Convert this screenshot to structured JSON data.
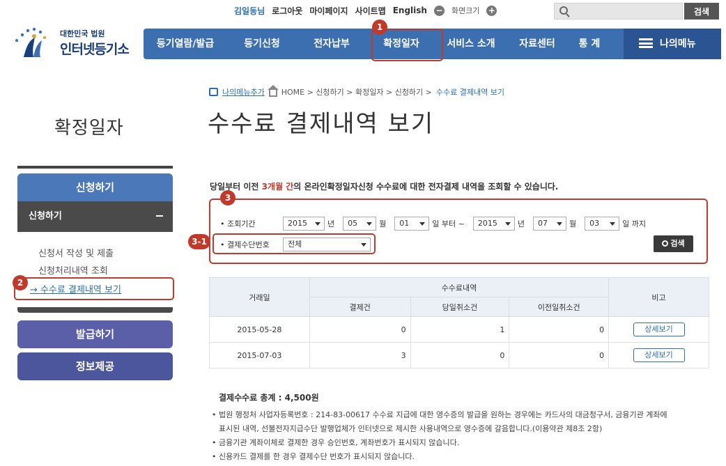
{
  "header": {
    "user_name": "김일동님",
    "logout": "로그아웃",
    "mypage": "마이페이지",
    "sitemap": "사이트맵",
    "english": "English",
    "font_size": "화면크기",
    "search_placeholder": "",
    "search_button": "검색"
  },
  "logo": {
    "sub": "대한민국 법원",
    "main": "인터넷등기소"
  },
  "nav": {
    "items": [
      "등기열람/발급",
      "등기신청",
      "전자납부",
      "확정일자",
      "서비스 소개",
      "자료센터",
      "통 계"
    ],
    "mymenu": "나의메뉴"
  },
  "badges": {
    "b1": "1",
    "b2": "2",
    "b3": "3",
    "b31": "3-1"
  },
  "breadcrumb": {
    "add": "나의메뉴추가",
    "path": "HOME > 신청하기 > 확정일자 > 신청하기 >",
    "current": "수수료 결제내역 보기"
  },
  "page_title": "수수료 결제내역 보기",
  "side_title": "확정일자",
  "sidebar": {
    "head": "신청하기",
    "sub": "신청하기",
    "links": [
      "신청서 작성 및 제출",
      "신청처리내역 조회",
      "→ 수수료 결제내역 보기"
    ],
    "btn_issue": "발급하기",
    "btn_info": "정보제공"
  },
  "intro": {
    "pre": "당일부터 이전 ",
    "red": "3개월 간",
    "post": "의 온라인확정일자신청 수수료에 대한 전자결제 내역을 조회할 수 있습니다."
  },
  "search": {
    "period_label": "• 조회기간",
    "from_year": "2015",
    "from_month": "05",
    "from_day": "01",
    "to_year": "2015",
    "to_month": "07",
    "to_day": "03",
    "unit_year": "년",
    "unit_month": "월",
    "unit_from": "일 부터 ~",
    "unit_to": "일 까지",
    "method_label": "• 결제수단번호",
    "method_value": "전체",
    "query_button": "검색"
  },
  "table": {
    "headers": {
      "date": "거래일",
      "fee": "수수료내역",
      "paid": "결제건",
      "cancel_today": "당일취소건",
      "cancel_prev": "이전일취소건",
      "note": "비고"
    },
    "rows": [
      {
        "date": "2015-05-28",
        "paid": "0",
        "cancel_today": "1",
        "cancel_prev": "0",
        "detail": "상세보기"
      },
      {
        "date": "2015-07-03",
        "paid": "3",
        "cancel_today": "0",
        "cancel_prev": "0",
        "detail": "상세보기"
      }
    ]
  },
  "total": "결제수수료 총계 : 4,500원",
  "notes": [
    "법원 행정처 사업자등록번호 : 214-83-00617 수수료 지급에 대한 영수증의 발급을 원하는 경우에는 카드사의 대금청구서, 금융기관 계좌에",
    "표시된 내역, 선불전자지급수단 발행업체가 인터넷으로 제시한 사용내역으로 영수증에 갈음합니다.(이용약관 제8조 2항)",
    "금융기관 계좌이체로 결제한 경우 승인번호, 계좌번호가 표시되지 않습니다.",
    "신용카드 결제를 한 경우 결제수단 번호가 표시되지 않습니다."
  ]
}
